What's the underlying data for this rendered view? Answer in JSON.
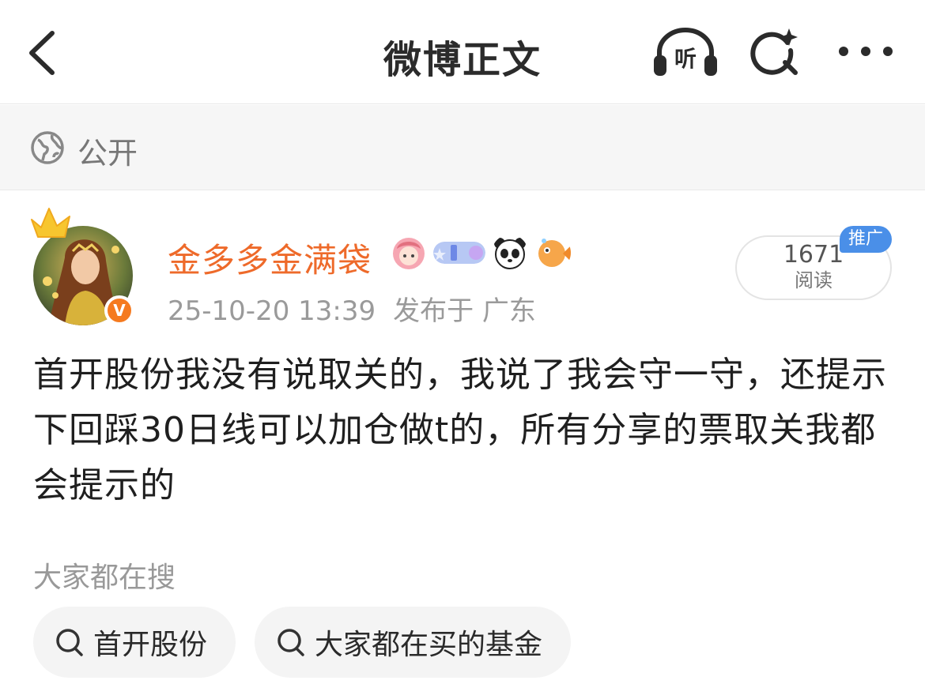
{
  "header": {
    "title": "微博正文",
    "listen_label": "听"
  },
  "visibility": {
    "label": "公开"
  },
  "post": {
    "author": "金多多金满袋",
    "verified_mark": "V",
    "time": "25-10-20 13:39",
    "location": "发布于 广东",
    "read_count": {
      "number": "1671",
      "label": "阅读",
      "tag": "推广"
    },
    "content": "首开股份我没有说取关的，我说了我会守一守，还提示下回踩30日线可以加仓做t的，所有分享的票取关我都会提示的"
  },
  "search": {
    "title": "大家都在搜",
    "chips": [
      {
        "label": "首开股份"
      },
      {
        "label": "大家都在买的基金"
      }
    ]
  },
  "colors": {
    "accent_orange": "#ee6a2a",
    "promo_blue": "#4a8fe8",
    "verified_orange": "#f57a1f"
  },
  "icons": [
    "back-icon",
    "headphones-icon",
    "search-icon",
    "more-icon",
    "globe-icon",
    "crown-icon"
  ]
}
